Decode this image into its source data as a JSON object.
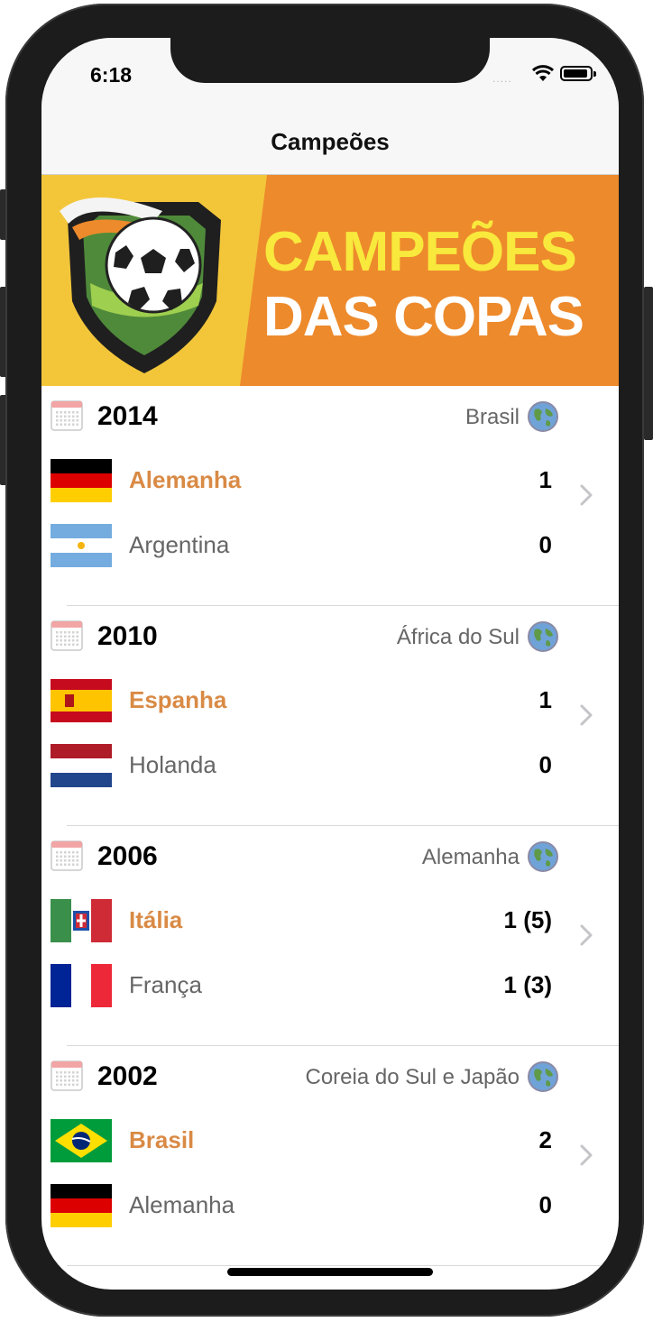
{
  "status": {
    "time": "6:18",
    "signal": "....."
  },
  "nav": {
    "title": "Campeões"
  },
  "banner": {
    "line1": "CAMPEÕES",
    "line2": "DAS COPAS"
  },
  "colors": {
    "winner": "#d98a45",
    "runner": "#666666",
    "banner_orange": "#ed8a2c",
    "banner_yellow": "#f3c63a"
  },
  "cups": [
    {
      "year": "2014",
      "host": "Brasil",
      "winner": {
        "name": "Alemanha",
        "score": "1",
        "flag": "germany"
      },
      "runner": {
        "name": "Argentina",
        "score": "0",
        "flag": "argentina"
      }
    },
    {
      "year": "2010",
      "host": "África do Sul",
      "winner": {
        "name": "Espanha",
        "score": "1",
        "flag": "spain"
      },
      "runner": {
        "name": "Holanda",
        "score": "0",
        "flag": "netherlands"
      }
    },
    {
      "year": "2006",
      "host": "Alemanha",
      "winner": {
        "name": "Itália",
        "score": "1 (5)",
        "flag": "italy"
      },
      "runner": {
        "name": "França",
        "score": "1 (3)",
        "flag": "france"
      }
    },
    {
      "year": "2002",
      "host": "Coreia do Sul e Japão",
      "winner": {
        "name": "Brasil",
        "score": "2",
        "flag": "brazil"
      },
      "runner": {
        "name": "Alemanha",
        "score": "0",
        "flag": "germany"
      }
    }
  ],
  "icons": {
    "calendar": "calendar-icon",
    "globe": "globe-icon",
    "chevron": "chevron-right-icon"
  }
}
